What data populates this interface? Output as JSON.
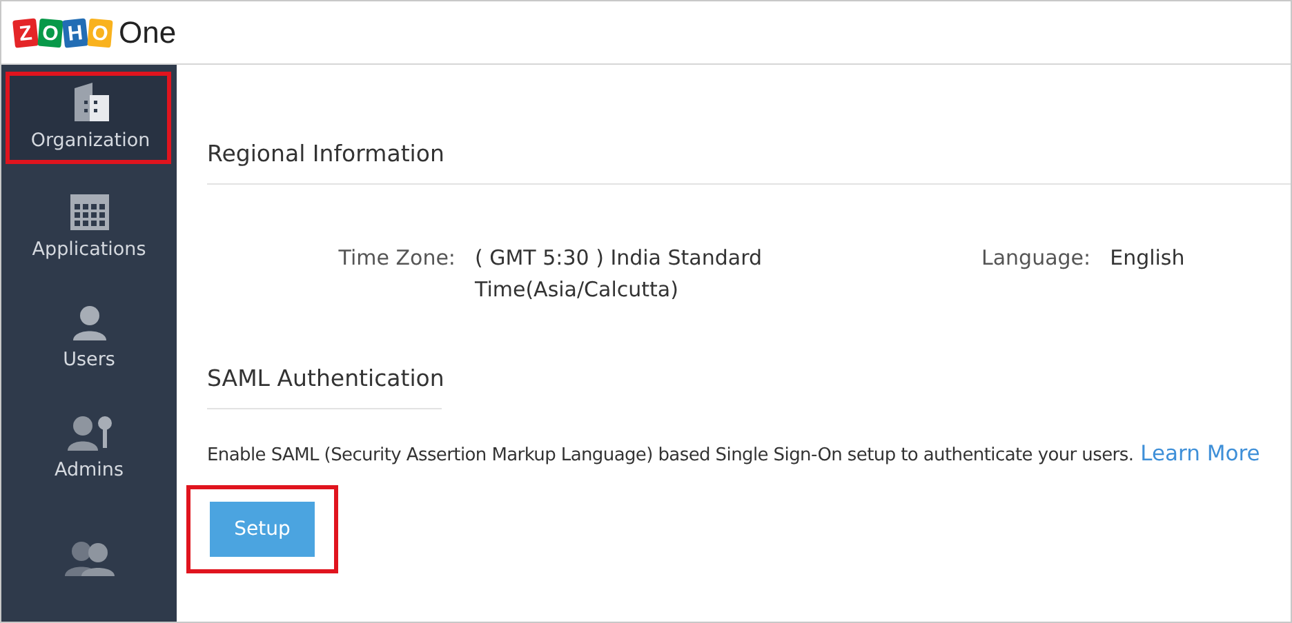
{
  "logo": {
    "letters": [
      {
        "text": "Z",
        "color": "#e42527"
      },
      {
        "text": "O",
        "color": "#089949"
      },
      {
        "text": "H",
        "color": "#226db4"
      },
      {
        "text": "O",
        "color": "#f9b21d"
      }
    ],
    "product": "One"
  },
  "sidebar": {
    "items": [
      {
        "kind": "building",
        "label": "Organization",
        "selected": true,
        "highlighted": true
      },
      {
        "kind": "grid",
        "label": "Applications",
        "selected": false,
        "highlighted": false
      },
      {
        "kind": "user",
        "label": "Users",
        "selected": false,
        "highlighted": false
      },
      {
        "kind": "admin",
        "label": "Admins",
        "selected": false,
        "highlighted": false
      },
      {
        "kind": "group",
        "selected": false,
        "highlighted": false
      }
    ]
  },
  "regional": {
    "heading": "Regional Information",
    "fields": [
      {
        "label": "Time Zone:",
        "value": "( GMT 5:30 ) India Standard Time(Asia/Calcutta)"
      },
      {
        "label": "Language:",
        "value": "English"
      }
    ]
  },
  "saml": {
    "heading": "SAML Authentication",
    "description": "Enable SAML (Security Assertion Markup Language) based Single Sign-On setup to authenticate your users.",
    "link": "Learn More",
    "button": {
      "label": "Setup",
      "highlighted": true
    }
  }
}
